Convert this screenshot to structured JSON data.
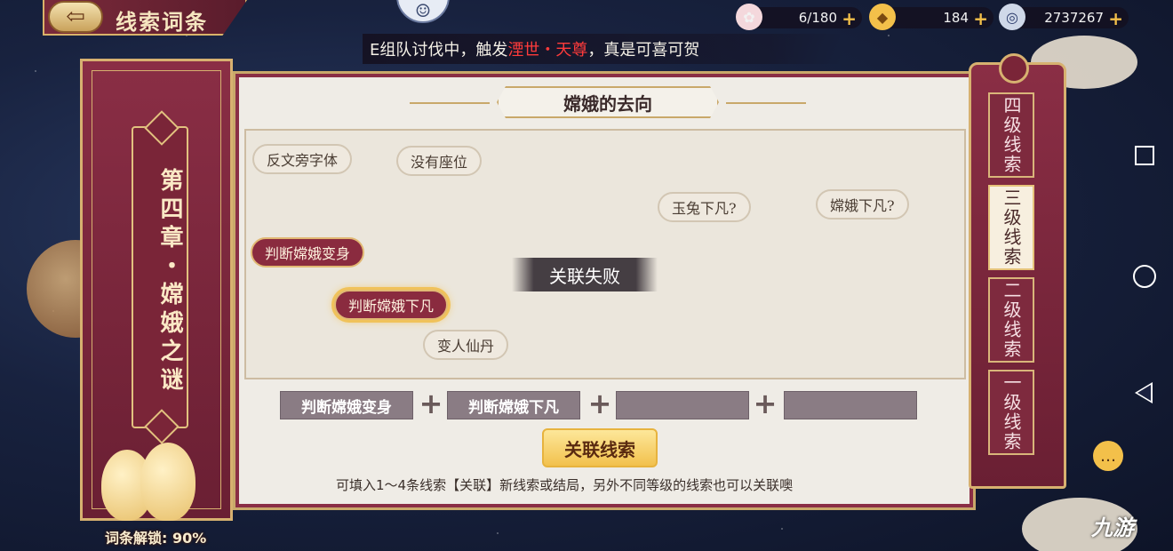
{
  "header": {
    "title": "线索词条",
    "back_icon": "arrow-left-icon"
  },
  "resources": [
    {
      "icon": "peach-icon",
      "value": "6/180"
    },
    {
      "icon": "gold-ingot-icon",
      "value": "184"
    },
    {
      "icon": "coin-icon",
      "value": "2737267"
    }
  ],
  "ticker": {
    "before": "E组队讨伐中，触发",
    "highlight": "湮世・天尊",
    "after": "，真是可喜可贺"
  },
  "chapter": {
    "title": "第四章・嫦娥之谜",
    "unlock": "词条解锁: 90%"
  },
  "board": {
    "title": "嫦娥的去向",
    "clues": [
      {
        "text": "反文旁字体",
        "style": "plain"
      },
      {
        "text": "没有座位",
        "style": "plain"
      },
      {
        "text": "玉兔下凡?",
        "style": "plain"
      },
      {
        "text": "嫦娥下凡?",
        "style": "plain"
      },
      {
        "text": "判断嫦娥变身",
        "style": "red"
      },
      {
        "text": "判断嫦娥下凡",
        "style": "red-selected"
      },
      {
        "text": "变人仙丹",
        "style": "plain"
      }
    ],
    "toast": "关联失败"
  },
  "slots": [
    "判断嫦娥变身",
    "判断嫦娥下凡",
    "",
    ""
  ],
  "link_button": "关联线索",
  "hint": "可填入1～4条线索【关联】新线索或结局，另外不同等级的线索也可以关联噢",
  "levels": [
    {
      "label": "四级线索",
      "active": false
    },
    {
      "label": "三级线索",
      "active": true
    },
    {
      "label": "二级线索",
      "active": false
    },
    {
      "label": "一级线索",
      "active": false
    }
  ],
  "watermark": "九游",
  "colors": {
    "accent": "#8a2e45",
    "gold": "#d7b170",
    "button": "#f2c14d",
    "alert": "#ff3b3b"
  }
}
